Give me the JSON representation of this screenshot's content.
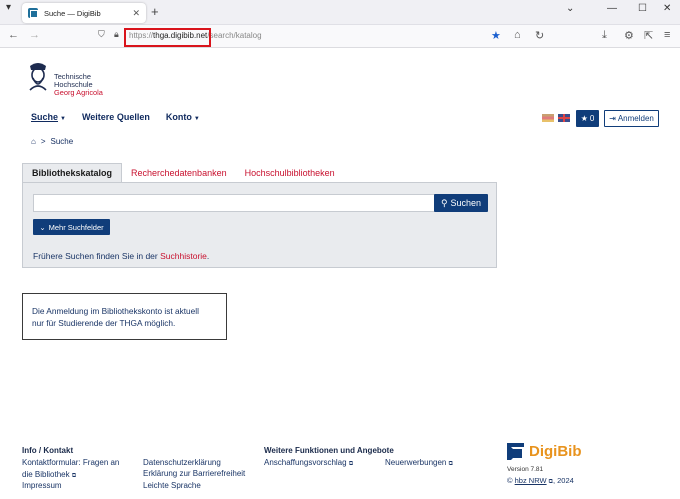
{
  "browser": {
    "tab_title": "Suche — DigiBib",
    "url_prefix": "https://",
    "url_domain": "thga.digibib.net",
    "url_path": "/search/katalog"
  },
  "logo": {
    "line1": "Technische",
    "line2": "Hochschule",
    "line3": "Georg Agricola"
  },
  "nav": {
    "search": "Suche",
    "more_sources": "Weitere Quellen",
    "account": "Konto"
  },
  "header_actions": {
    "watchlist_count": "0",
    "login": "Anmelden"
  },
  "breadcrumb": {
    "current": "Suche"
  },
  "search_tabs": [
    "Bibliothekskatalog",
    "Recherchedatenbanken",
    "Hochschulbibliotheken"
  ],
  "search": {
    "input_value": "",
    "button": "Suchen",
    "more_fields": "Mehr Suchfelder",
    "history_prefix": "Frühere Suchen finden Sie in der ",
    "history_link": "Suchhistorie",
    "history_suffix": "."
  },
  "notice": {
    "line1": "Die Anmeldung im Bibliothekskonto ist aktuell",
    "line2": "nur für Studierende der THGA möglich."
  },
  "footer": {
    "col1_title": "Info / Kontakt",
    "contact_line1": "Kontaktformular: Fragen an",
    "contact_line2": "die Bibliothek",
    "imprint": "Impressum",
    "privacy": "Datenschutzerklärung",
    "accessibility": "Erklärung zur Barrierefreiheit",
    "easy_language": "Leichte Sprache",
    "col3_title": "Weitere Funktionen und Angebote",
    "acquisition": "Anschaffungsvorschlag",
    "new_arrivals": "Neuerwerbungen",
    "brand": "DigiBib",
    "version": "Version 7.81",
    "copy_prefix": "© ",
    "copy_link": "hbz NRW",
    "copy_year": ", 2024"
  },
  "colors": {
    "primary": "#103d7a",
    "accent": "#c8102e",
    "brand_orange": "#e8931e"
  }
}
